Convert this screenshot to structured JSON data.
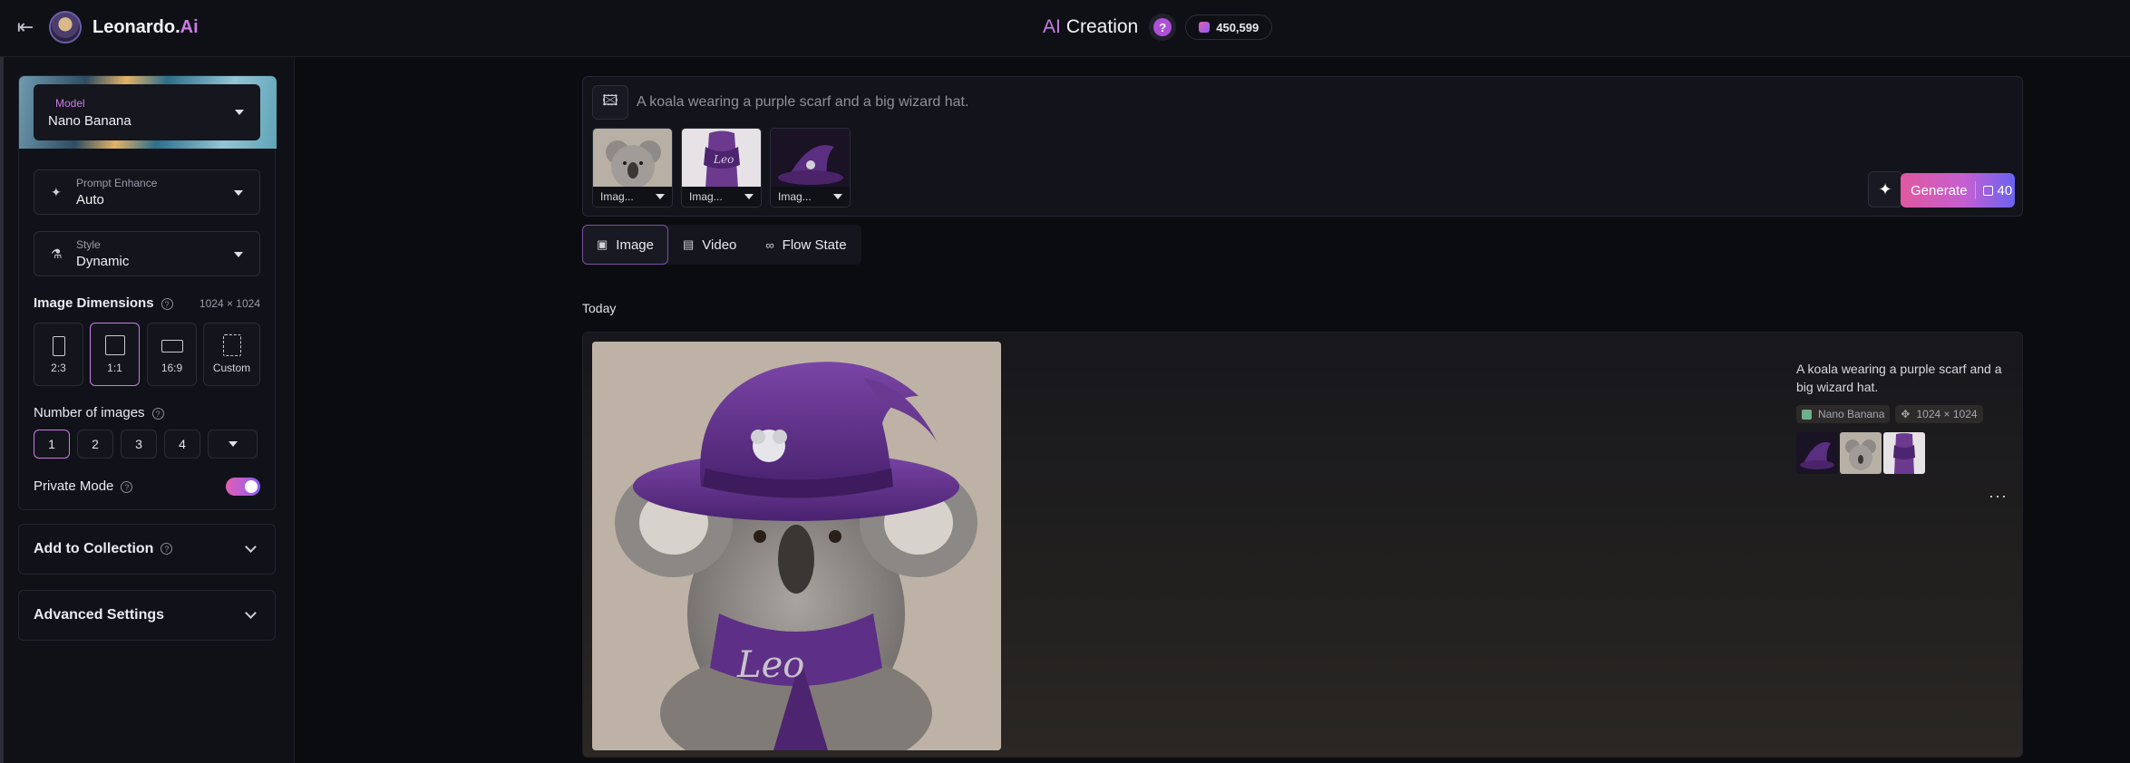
{
  "topbar": {
    "brand_name": "Leonardo.",
    "brand_suffix": "Ai",
    "title_prefix": "AI",
    "title_main": "Creation",
    "help_label": "?",
    "token_balance": "450,599"
  },
  "sidebar": {
    "model": {
      "label": "Model",
      "value": "Nano Banana"
    },
    "prompt_enhance": {
      "label": "Prompt Enhance",
      "value": "Auto"
    },
    "style": {
      "label": "Style",
      "value": "Dynamic"
    },
    "image_dimensions": {
      "label": "Image Dimensions",
      "value": "1024 × 1024",
      "options": [
        "2:3",
        "1:1",
        "16:9",
        "Custom"
      ],
      "selected": "1:1"
    },
    "number_of_images": {
      "label": "Number of images",
      "options": [
        "1",
        "2",
        "3",
        "4"
      ],
      "selected": "1"
    },
    "private_mode": {
      "label": "Private Mode",
      "enabled": true
    },
    "add_to_collection": "Add to Collection",
    "advanced_settings": "Advanced Settings"
  },
  "prompt": {
    "text": "A koala wearing a purple scarf and a big wizard hat.",
    "image_refs": [
      {
        "label": "Imag..."
      },
      {
        "label": "Imag..."
      },
      {
        "label": "Imag..."
      }
    ],
    "generate_label": "Generate",
    "generate_cost": "40"
  },
  "tabs": [
    {
      "label": "Image",
      "icon": "image-icon",
      "selected": true
    },
    {
      "label": "Video",
      "icon": "video-icon",
      "selected": false
    },
    {
      "label": "Flow State",
      "icon": "infinity-icon",
      "selected": false
    }
  ],
  "feed": {
    "section_label": "Today",
    "items": [
      {
        "prompt": "A koala wearing a purple scarf and a big wizard hat.",
        "model": "Nano Banana",
        "dimensions": "1024 × 1024",
        "scarf_text": "Leo"
      }
    ]
  },
  "colors": {
    "accent": "#c97ce6",
    "generate_gradient_start": "#e0589f",
    "generate_gradient_end": "#6a63f0",
    "hat_purple": "#5e2f86"
  }
}
